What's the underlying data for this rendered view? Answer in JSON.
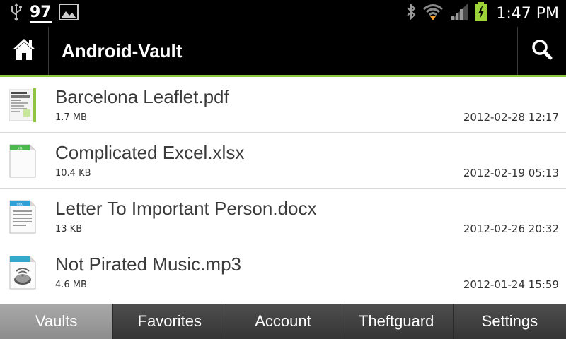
{
  "status_bar": {
    "usb_icon": "usb-icon",
    "notification_count": "97",
    "image_icon": "image-icon",
    "bluetooth_icon": "bluetooth-icon",
    "wifi_icon": "wifi-icon",
    "signal_icon": "signal-icon",
    "battery_icon": "battery-charging-icon",
    "time": "1:47 PM"
  },
  "action_bar": {
    "home_icon": "home-icon",
    "title": "Android-Vault",
    "search_icon": "search-icon",
    "accent_color": "#8dc63f"
  },
  "files": [
    {
      "name": "Barcelona Leaflet.pdf",
      "size": "1.7 MB",
      "date": "2012-02-28 12:17",
      "icon": "pdf-thumbnail-icon"
    },
    {
      "name": "Complicated Excel.xlsx",
      "size": "10.4 KB",
      "date": "2012-02-19 05:13",
      "icon": "xlsx-file-icon"
    },
    {
      "name": "Letter To Important Person.docx",
      "size": "13 KB",
      "date": "2012-02-26 20:32",
      "icon": "docx-file-icon"
    },
    {
      "name": "Not Pirated Music.mp3",
      "size": "4.6 MB",
      "date": "2012-01-24 15:59",
      "icon": "mp3-file-icon"
    }
  ],
  "tabs": [
    {
      "label": "Vaults",
      "active": true
    },
    {
      "label": "Favorites",
      "active": false
    },
    {
      "label": "Account",
      "active": false
    },
    {
      "label": "Theftguard",
      "active": false
    },
    {
      "label": "Settings",
      "active": false
    }
  ]
}
